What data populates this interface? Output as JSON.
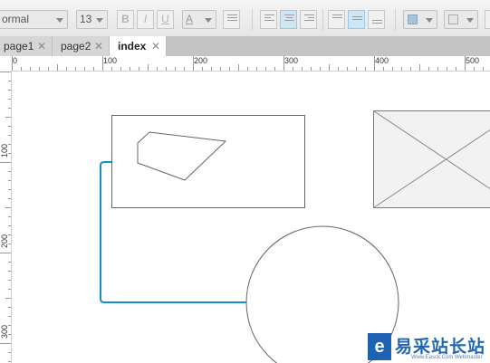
{
  "toolbar": {
    "style_select": "ormal",
    "font_size": "13",
    "bold": "B",
    "italic": "I",
    "underline": "U",
    "font_color": "A"
  },
  "tabs": [
    {
      "label": "page1"
    },
    {
      "label": "page2"
    },
    {
      "label": "index"
    }
  ],
  "tab_close": "✕",
  "ruler": {
    "top": [
      "0",
      "100",
      "200",
      "300",
      "400",
      "500"
    ],
    "left": [
      "100",
      "200",
      "300"
    ]
  },
  "colors": {
    "connector": "#1a8fc4",
    "toolbar_active": "#cfe6f5",
    "placeholder_fill": "#f2f2f2"
  },
  "watermark": {
    "logo": "e",
    "text": "易采站长站",
    "sub": "Www.Easck.Com Webmaster"
  }
}
